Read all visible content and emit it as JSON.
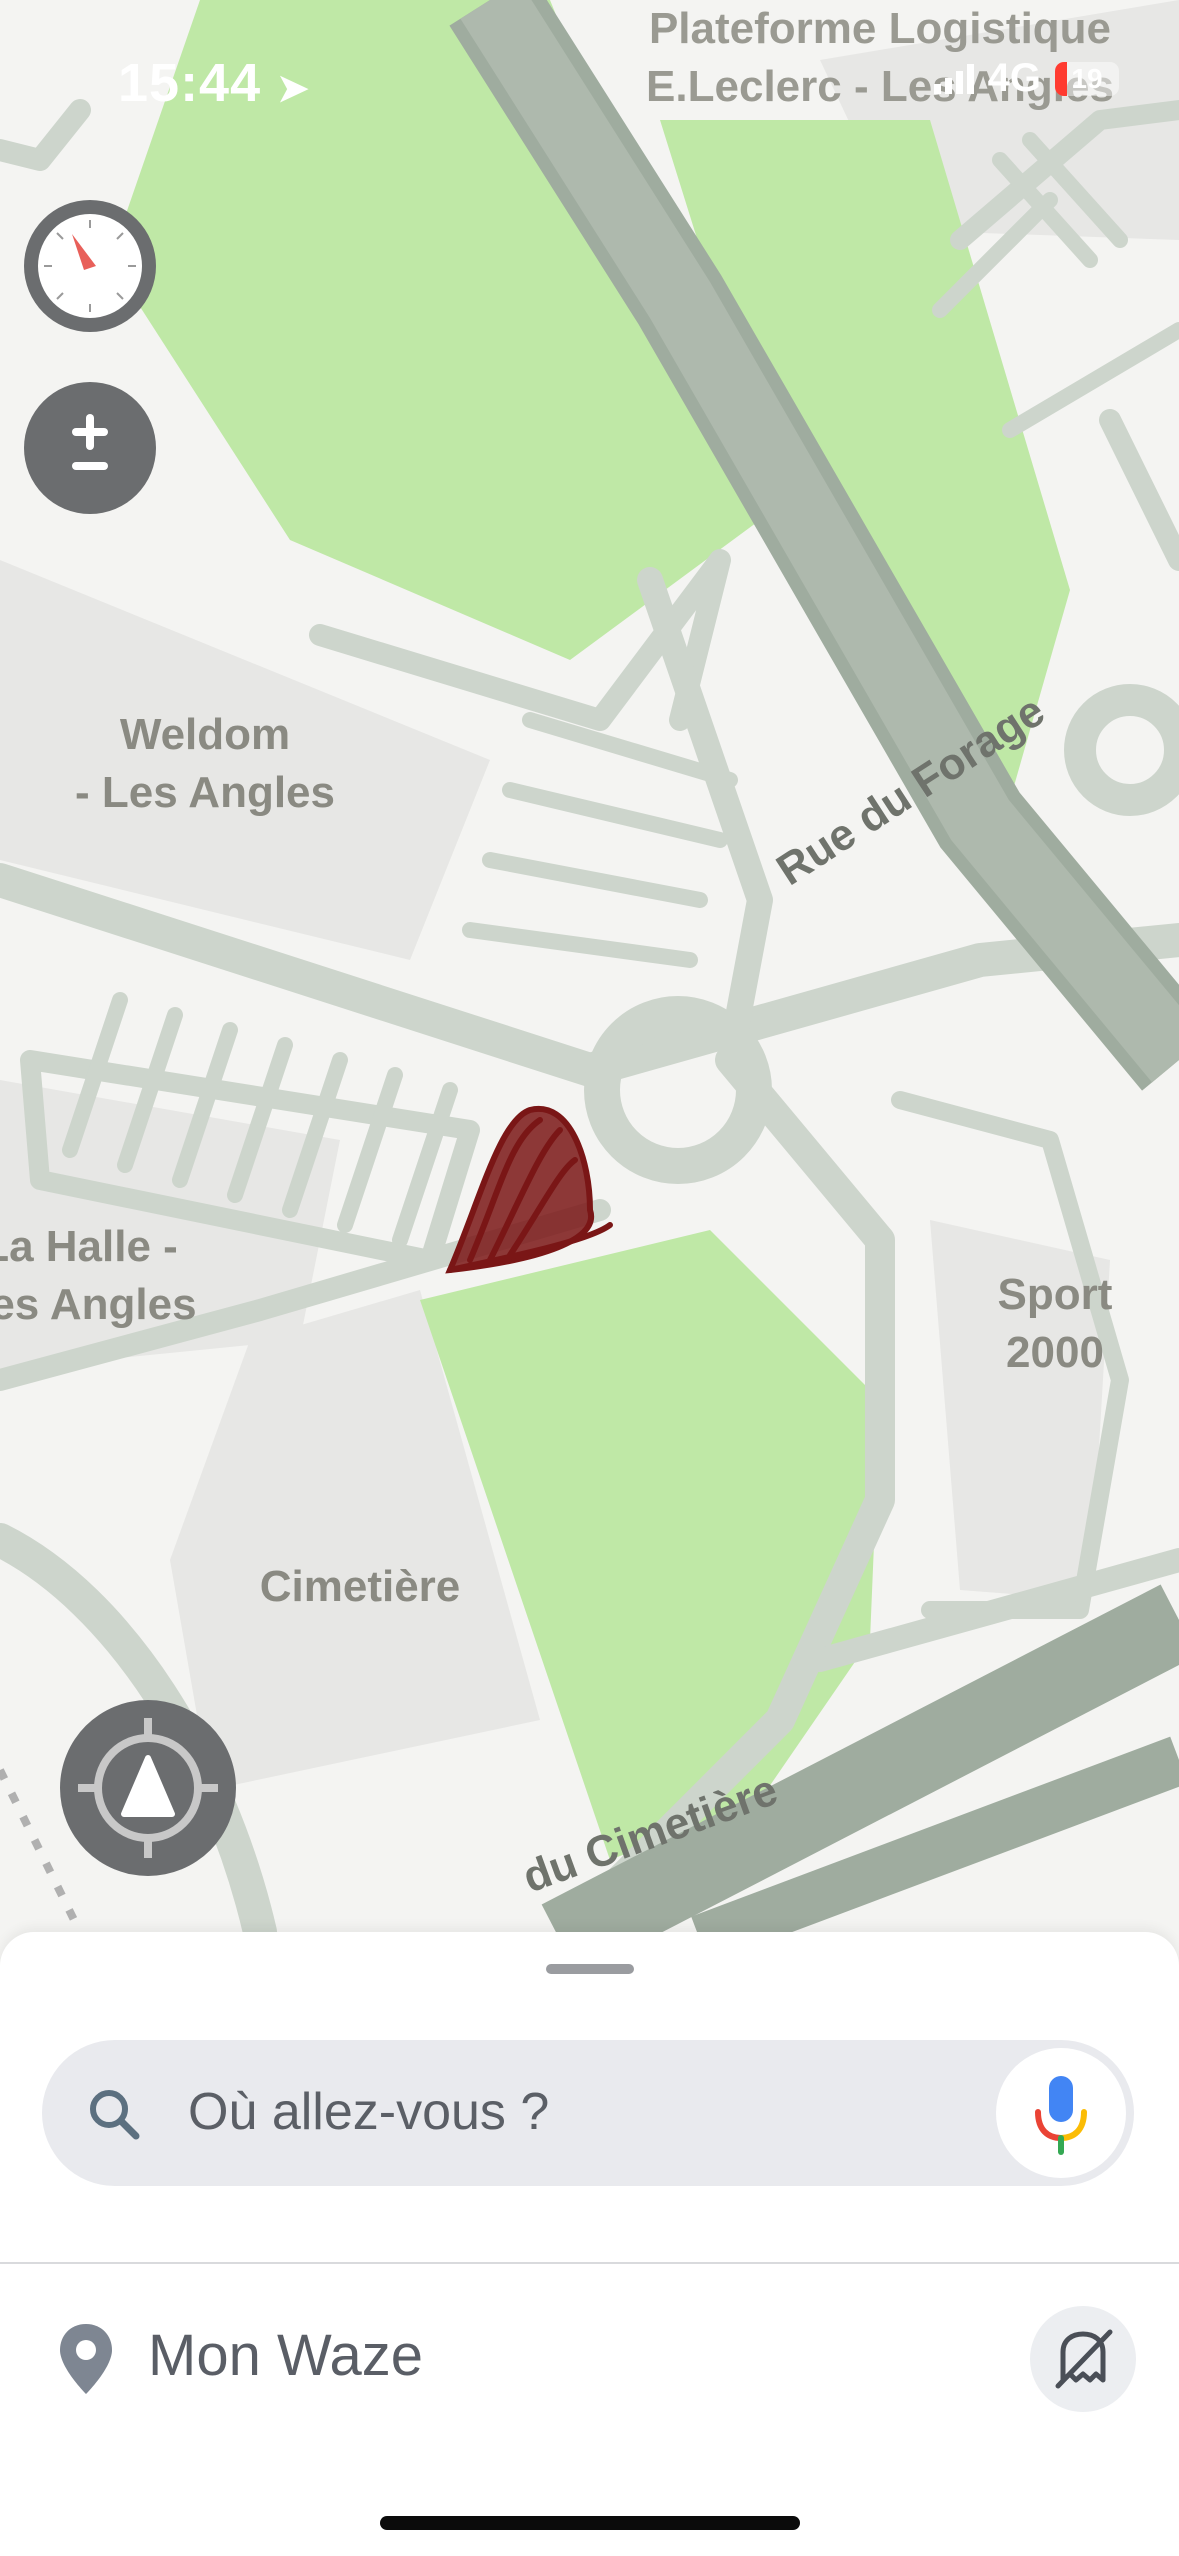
{
  "status_bar": {
    "time": "15:44",
    "network": "4G",
    "battery": "19"
  },
  "map": {
    "labels": {
      "top_poi": "Plateforme Logistique\nE.Leclerc - Les Angles",
      "weldom": "Weldom\n- Les Angles",
      "halle": "La Halle -\nLes Angles",
      "sport": "Sport\n2000",
      "cimetiere": "Cimetière",
      "rue_forage": "Rue du Forage",
      "rue_cimetiere": "du Cimetière"
    },
    "colors": {
      "park": "#bfe8a6",
      "road": "#cdd5cc",
      "road_dark": "#9aa89a",
      "building": "#e7e7e5",
      "annotation": "#7a1616"
    }
  },
  "search": {
    "placeholder": "Où allez-vous ?"
  },
  "bottom_menu": {
    "my_waze_label": "Mon Waze"
  },
  "icons": {
    "compass": "compass-icon",
    "zoom": "zoom-icon",
    "recenter": "recenter-icon",
    "search": "search-icon",
    "mic": "microphone-icon",
    "pin": "location-pin-icon",
    "ghost": "invisible-mode-icon"
  }
}
